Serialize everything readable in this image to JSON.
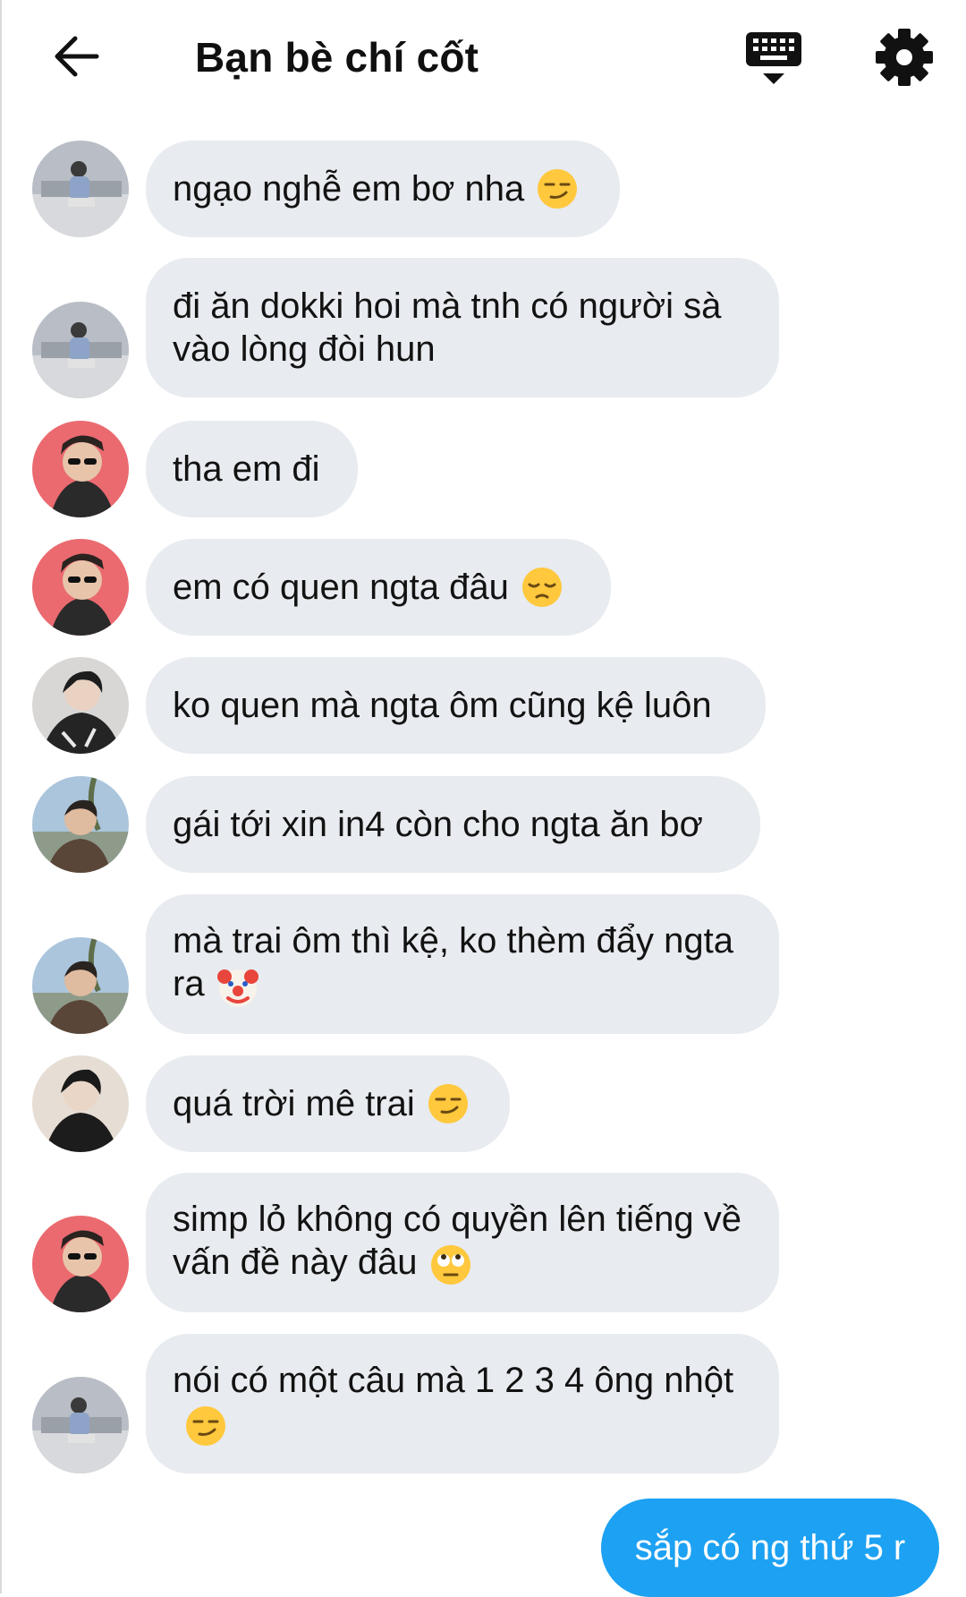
{
  "header": {
    "title": "Bạn bè chí cốt",
    "back_icon": "arrow-left-icon",
    "keyboard_icon": "keyboard-icon",
    "settings_icon": "gear-icon"
  },
  "messages": [
    {
      "text": "ngạo nghễ em bơ nha",
      "emoji": "smirk",
      "avatar": "photo-a"
    },
    {
      "text": "đi ăn dokki hoi mà tnh có người sà vào lòng đòi hun",
      "emoji": "",
      "avatar": "photo-a"
    },
    {
      "text": "tha em đi",
      "emoji": "",
      "avatar": "photo-b"
    },
    {
      "text": "em có quen ngta đâu",
      "emoji": "pensive",
      "avatar": "photo-b"
    },
    {
      "text": "ko quen mà ngta ôm cũng kệ luôn",
      "emoji": "",
      "avatar": "photo-c"
    },
    {
      "text": "gái tới xin in4 còn cho ngta ăn bơ",
      "emoji": "",
      "avatar": "photo-d"
    },
    {
      "text": "mà trai ôm thì kệ, ko thèm đẩy ngta ra",
      "emoji": "clown",
      "avatar": "photo-d"
    },
    {
      "text": "quá trời mê trai",
      "emoji": "smirk",
      "avatar": "photo-e"
    },
    {
      "text": "simp lỏ không có quyền lên tiếng về vấn đề này đâu",
      "emoji": "eye-roll",
      "avatar": "photo-b"
    },
    {
      "text": "nói có một câu mà 1 2 3 4 ông nhột",
      "emoji": "smirk",
      "avatar": "photo-a"
    }
  ],
  "my_message": {
    "text": "sắp có ng thứ 5 r"
  },
  "colors": {
    "bubble": "#e8ebef",
    "accent": "#1da1f2",
    "background": "#ffffff"
  }
}
